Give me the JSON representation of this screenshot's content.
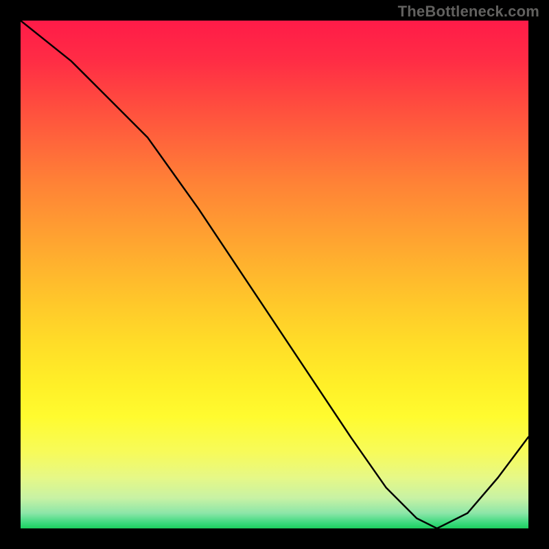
{
  "attribution": "TheBottleneck.com",
  "bottom_label": "",
  "chart_data": {
    "type": "line",
    "title": "",
    "xlabel": "",
    "ylabel": "",
    "xlim": [
      0,
      100
    ],
    "ylim": [
      0,
      100
    ],
    "series": [
      {
        "name": "curve",
        "x": [
          0,
          10,
          18,
          25,
          35,
          45,
          55,
          65,
          72,
          78,
          82,
          88,
          94,
          100
        ],
        "values": [
          100,
          92,
          84,
          77,
          63,
          48,
          33,
          18,
          8,
          2,
          0,
          3,
          10,
          18
        ]
      }
    ],
    "gradient_stops": [
      {
        "pos": 0,
        "color": "#ff1b48"
      },
      {
        "pos": 50,
        "color": "#ffc92a"
      },
      {
        "pos": 80,
        "color": "#fffb2f"
      },
      {
        "pos": 100,
        "color": "#1dcf5e"
      }
    ]
  }
}
